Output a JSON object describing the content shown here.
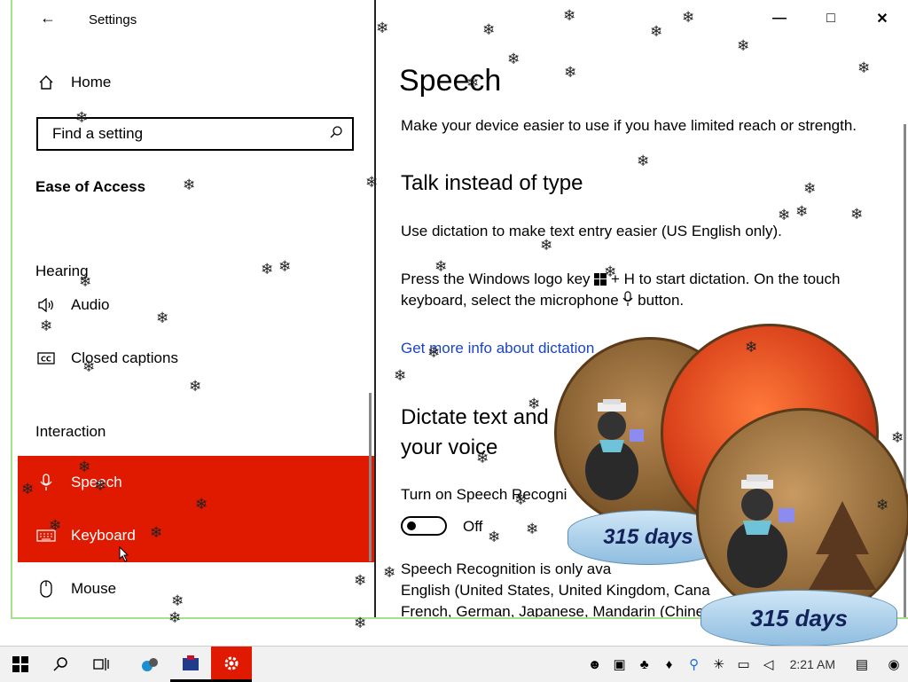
{
  "window": {
    "title": "Settings",
    "back_glyph": "←",
    "controls": {
      "minimize": "—",
      "maximize": "□",
      "close": "✕"
    }
  },
  "sidebar": {
    "home_label": "Home",
    "search_placeholder": "Find a setting",
    "category": "Ease of Access",
    "sections": [
      {
        "title": "Hearing",
        "items": [
          {
            "label": "Audio",
            "icon": "speaker-icon"
          },
          {
            "label": "Closed captions",
            "icon": "cc-icon"
          }
        ]
      },
      {
        "title": "Interaction",
        "items": [
          {
            "label": "Speech",
            "icon": "microphone-icon",
            "selected": true
          },
          {
            "label": "Keyboard",
            "icon": "keyboard-icon",
            "hovered": true
          },
          {
            "label": "Mouse",
            "icon": "mouse-icon"
          }
        ]
      }
    ],
    "highlight_color": "#e01a00"
  },
  "content": {
    "title": "Speech",
    "description": "Make your device easier to use if you have limited reach or strength.",
    "talk_heading": "Talk instead of type",
    "dictation_text": "Use dictation to make text entry easier (US English only).",
    "press_text_1": "Press the Windows logo key",
    "press_text_2": "+ H to start dictation.  On the touch",
    "press_text_3": "keyboard, select the microphone",
    "press_text_4": "button.",
    "link": "Get more info about dictation",
    "dictate_heading_1": "Dictate text and",
    "dictate_heading_2": "your voice",
    "speech_recog_label": "Turn on Speech Recogni",
    "toggle_state": "Off",
    "speech_recog_desc_1": "Speech Recognition is only ava",
    "speech_recog_desc_2": "English (United States, United Kingdom, Cana",
    "speech_recog_desc_3": "French, German, Japanese, Mandarin (Chines"
  },
  "overlay": {
    "globe_caption_small": "315 days",
    "globe_caption_large": "315 days"
  },
  "taskbar": {
    "clock": "2:21 AM",
    "icons": [
      "windows-icon",
      "search-icon",
      "task-view-icon",
      "app-icon",
      "app-icon",
      "settings-icon"
    ]
  }
}
